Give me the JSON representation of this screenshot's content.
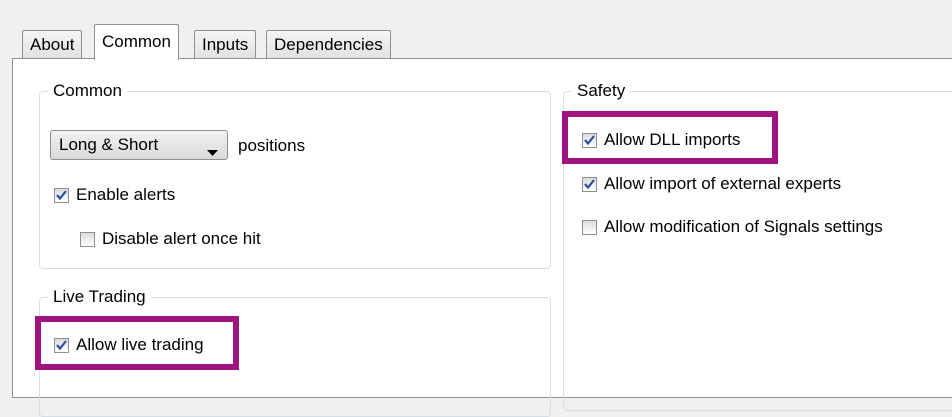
{
  "tabs": [
    {
      "label": "About"
    },
    {
      "label": "Common"
    },
    {
      "label": "Inputs"
    },
    {
      "label": "Dependencies"
    }
  ],
  "common_group": {
    "title": "Common",
    "positions_dropdown": {
      "value": "Long & Short",
      "icon": "chevron-down-icon"
    },
    "positions_label": "positions",
    "enable_alerts": {
      "label": "Enable alerts",
      "checked": true
    },
    "disable_alert_once_hit": {
      "label": "Disable alert once hit",
      "checked": false
    }
  },
  "live_trading_group": {
    "title": "Live Trading",
    "allow_live_trading": {
      "label": "Allow live trading",
      "checked": true
    }
  },
  "safety_group": {
    "title": "Safety",
    "allow_dll_imports": {
      "label": "Allow DLL imports",
      "checked": true
    },
    "allow_import_external_experts": {
      "label": "Allow import of external experts",
      "checked": true
    },
    "allow_modification_signals": {
      "label": "Allow modification of Signals settings",
      "checked": false
    }
  },
  "highlight_color": "#a0147f"
}
